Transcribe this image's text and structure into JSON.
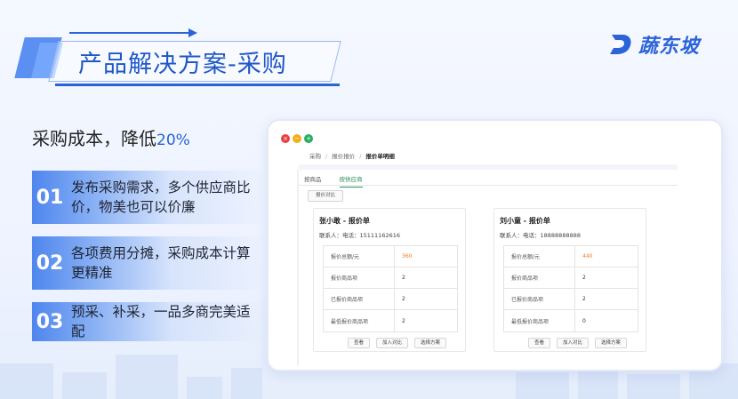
{
  "header": {
    "title": "产品解决方案-采购"
  },
  "logo": {
    "text": "蔬东坡",
    "icon": "logo-mark-icon"
  },
  "headline": {
    "text": "采购成本，降低",
    "highlight": "20%"
  },
  "features": [
    {
      "num": "01",
      "text": "发布采购需求，多个供应商比价，物美也可以价廉"
    },
    {
      "num": "02",
      "text": "各项费用分摊，采购成本计算更精准"
    },
    {
      "num": "03",
      "text": "预采、补采，一品多商完美适配"
    }
  ],
  "app": {
    "window_controls": [
      "×",
      "−",
      "+"
    ],
    "breadcrumb": [
      "采购",
      "报价报价",
      "报价单明细"
    ],
    "breadcrumb_sep": "/",
    "tabs": [
      "按商品",
      "按供应商"
    ],
    "active_tab": 1,
    "compare_button": "报价对比",
    "quotes": [
      {
        "title": "张小敢 - 报价单",
        "contact": "联系人：电话：15111162616",
        "rows": [
          {
            "label": "报价总额/元",
            "value": "360"
          },
          {
            "label": "报价商品项",
            "value": "2"
          },
          {
            "label": "已报价商品项",
            "value": "2"
          },
          {
            "label": "最低报价商品项",
            "value": "2"
          }
        ],
        "actions": [
          "查看",
          "加入对比",
          "选择方案"
        ]
      },
      {
        "title": "刘小童 - 报价单",
        "contact": "联系人：电话：18888888888",
        "rows": [
          {
            "label": "报价总额/元",
            "value": "440"
          },
          {
            "label": "报价商品项",
            "value": "2"
          },
          {
            "label": "已报价商品项",
            "value": "2"
          },
          {
            "label": "最低报价商品项",
            "value": "0"
          }
        ],
        "actions": [
          "查看",
          "加入对比",
          "选择方案"
        ]
      }
    ]
  },
  "colors": {
    "brand": "#2b63d9",
    "title": "#1f57c8",
    "active_tab": "#2d8f5b",
    "price": "#f07b28"
  }
}
